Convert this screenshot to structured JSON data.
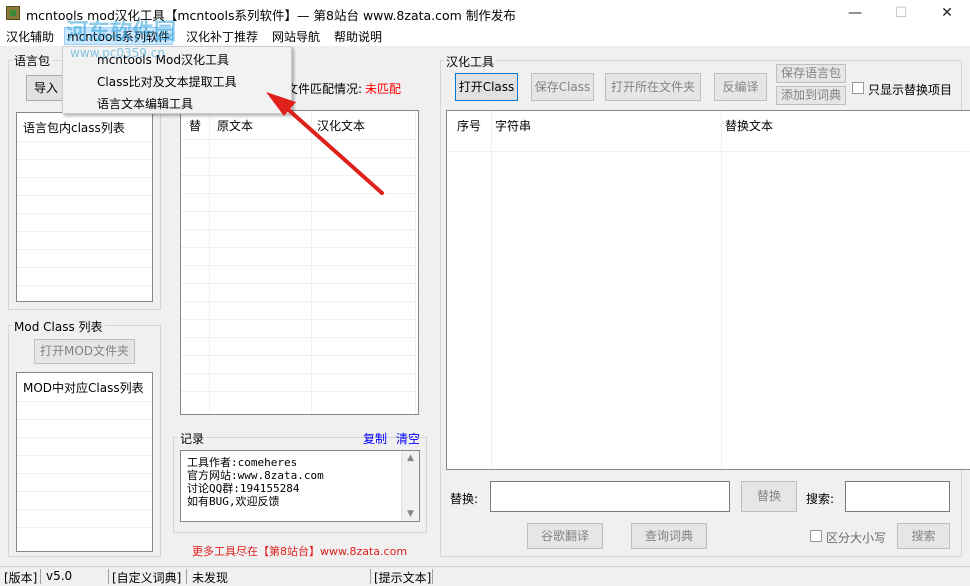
{
  "window": {
    "title": "mcntools mod汉化工具【mcntools系列软件】— 第8站台 www.8zata.com 制作发布",
    "minimize": "—",
    "maximize": "☐",
    "close": "✕"
  },
  "menu": {
    "items": [
      "汉化辅助",
      "mcntools系列软件",
      "汉化补丁推荐",
      "网站导航",
      "帮助说明"
    ]
  },
  "dropdown": {
    "items": [
      "mcntools Mod汉化工具",
      "Class比对及文本提取工具",
      "语言文本编辑工具"
    ]
  },
  "watermark": {
    "text": "河东软件园",
    "url": "www.pc0359.cn"
  },
  "language_pack": {
    "group_label": "语言包",
    "import_button": "导入",
    "match_label": "文件匹配情况:",
    "match_status": "未匹配",
    "class_list_header": "语言包内class列表"
  },
  "mod_class": {
    "group_label": "Mod Class 列表",
    "open_button": "打开MOD文件夹",
    "list_header": "MOD中对应Class列表"
  },
  "compare_table": {
    "columns": [
      "替",
      "原文本",
      "汉化文本"
    ]
  },
  "log": {
    "label": "记录",
    "copy_link": "复制",
    "clear_link": "清空",
    "lines": [
      "工具作者:comeheres",
      "官方网站:www.8zata.com",
      "讨论QQ群:194155284",
      "如有BUG,欢迎反馈"
    ]
  },
  "promo": {
    "prefix": "更多工具尽在【第8站台】",
    "url": "www.8zata.com"
  },
  "hanhua": {
    "group_label": "汉化工具",
    "open_class": "打开Class",
    "save_class": "保存Class",
    "open_folder": "打开所在文件夹",
    "decompile": "反编译",
    "save_lang": "保存语言包",
    "add_dict": "添加到词典",
    "only_show_replace": "只显示替换项目",
    "columns": [
      "序号",
      "字符串",
      "替换文本"
    ],
    "replace_label": "替换:",
    "replace_button": "替换",
    "search_label": "搜索:",
    "google_translate": "谷歌翻译",
    "lookup_dict": "查询词典",
    "case_sensitive": "区分大小写",
    "search_button": "搜索"
  },
  "status": {
    "version_label": "[版本]",
    "version": "v5.0",
    "dict_label": "[自定义词典]",
    "dict_value": "未发现",
    "hint_label": "[提示文本]"
  },
  "colors": {
    "accent": "#0078d7",
    "arrow": "#e0201a",
    "link": "#0000ff",
    "alert": "#ff0000"
  }
}
